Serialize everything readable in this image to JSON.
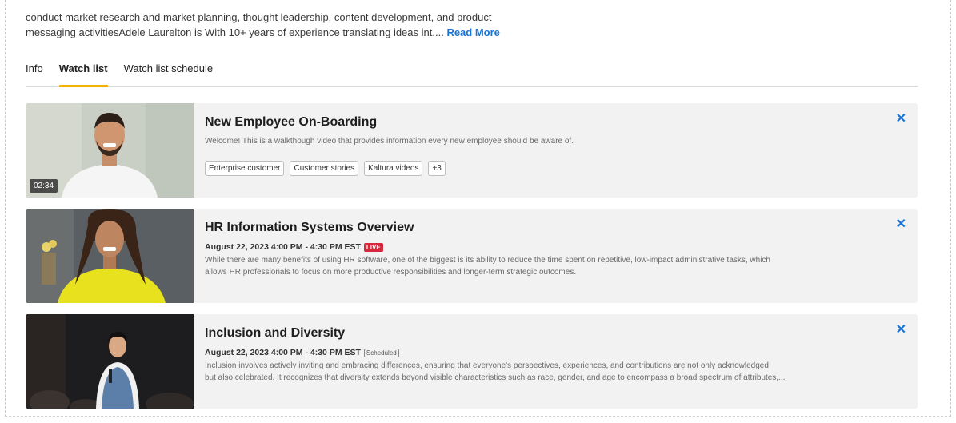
{
  "bio": {
    "line1": "conduct market research and market planning, thought leadership, content development, and product",
    "line2": "messaging activitiesAdele Laurelton is With 10+ years of experience translating ideas int....",
    "read_more": "Read More"
  },
  "tabs": [
    {
      "label": "Info",
      "active": false
    },
    {
      "label": "Watch list",
      "active": true
    },
    {
      "label": "Watch list schedule",
      "active": false
    }
  ],
  "accent_color": "#f4b200",
  "link_color": "#1a73d6",
  "watchlist": [
    {
      "title": "New Employee On-Boarding",
      "duration": "02:34",
      "description": "Welcome! This is a walkthough video that provides information every new employee should be aware of.",
      "tags": [
        "Enterprise customer",
        "Customer stories",
        "Kaltura videos",
        "+3"
      ]
    },
    {
      "title": "HR Information Systems Overview",
      "date": "August 22, 2023 4:00 PM - 4:30 PM EST",
      "badge": "LIVE",
      "description_line1": "While there are many benefits of using HR software, one of the biggest is its ability to reduce the time spent on repetitive, low-impact administrative tasks, which",
      "description_line2": "allows HR professionals to focus on more productive responsibilities and longer-term strategic outcomes."
    },
    {
      "title": "Inclusion and Diversity",
      "date": "August 22, 2023 4:00 PM - 4:30 PM EST",
      "badge": "Scheduled",
      "description_line1": "Inclusion involves actively inviting and embracing differences, ensuring that everyone's perspectives, experiences, and contributions are not only acknowledged",
      "description_line2": "but also celebrated. It recognizes that diversity extends beyond visible characteristics such as race, gender, and age to encompass a broad spectrum of attributes,..."
    }
  ]
}
